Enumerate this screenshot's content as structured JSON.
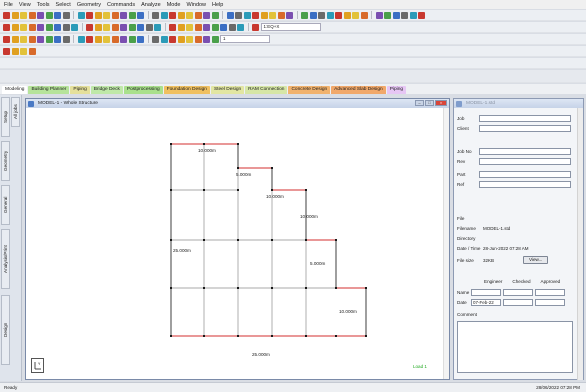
{
  "menu": [
    "File",
    "View",
    "Tools",
    "Select",
    "Geometry",
    "Commands",
    "Analyze",
    "Mode",
    "Window",
    "Help"
  ],
  "toolbar3": {
    "load_combo": "1:EQ+X",
    "view_combo": "1"
  },
  "tabs": [
    {
      "label": "Modeling",
      "bg": "#ffffff"
    },
    {
      "label": "Building Planner",
      "bg": "#b6e39a"
    },
    {
      "label": "Piping",
      "bg": "#e5e09b"
    },
    {
      "label": "Bridge Deck",
      "bg": "#bfe8a8"
    },
    {
      "label": "Postprocessing",
      "bg": "#a9e08c"
    },
    {
      "label": "Foundation Design",
      "bg": "#f0c060"
    },
    {
      "label": "Steel Design",
      "bg": "#e2e6a2"
    },
    {
      "label": "RAM Connection",
      "bg": "#d6e6a6"
    },
    {
      "label": "Concrete Design",
      "bg": "#f1b26d"
    },
    {
      "label": "Advanced Slab Design",
      "bg": "#f1a86a"
    },
    {
      "label": "Piping",
      "bg": "#e6c6f4"
    }
  ],
  "left_tabs": [
    "Setup",
    "Geometry",
    "General",
    "Analysis/Print",
    "Design"
  ],
  "left_tabs2": [
    "All jobs"
  ],
  "main_window": {
    "title": "MODEL-1 - Whole Structure"
  },
  "dimensions": {
    "top1": "10.000m",
    "top2": "5.000m",
    "top3": "10.000m",
    "right1": "10.000m",
    "right2": "5.000m",
    "right3": "10.000m",
    "left": "25.000m",
    "bottom": "25.000m"
  },
  "load_label": "Load 1",
  "right_panel": {
    "title": "MODEL-1.std",
    "fields": [
      {
        "label": "Job",
        "value": ""
      },
      {
        "label": "Client",
        "value": ""
      },
      {
        "label": "Job No",
        "value": ""
      },
      {
        "label": "Rev",
        "value": ""
      },
      {
        "label": "Part",
        "value": ""
      },
      {
        "label": "Ref",
        "value": ""
      }
    ],
    "file_label": "File",
    "filename_label": "Filename",
    "filename_value": "MODEL-1.std",
    "directory_label": "Directory",
    "datetime_label": "Date / Time",
    "datetime_value": "28-Jun-2022   07:28 AM",
    "filesize_label": "File size",
    "filesize_value": "32KB",
    "view_button": "View...",
    "sign_headers": [
      "Engineer",
      "Checked",
      "Approved"
    ],
    "name_label": "Name",
    "date_label": "Date",
    "date_value": "07-Feb-22",
    "comment_label": "Comment"
  },
  "status": {
    "left": "Ready",
    "right": "28/06/2022  07:28 PM"
  }
}
